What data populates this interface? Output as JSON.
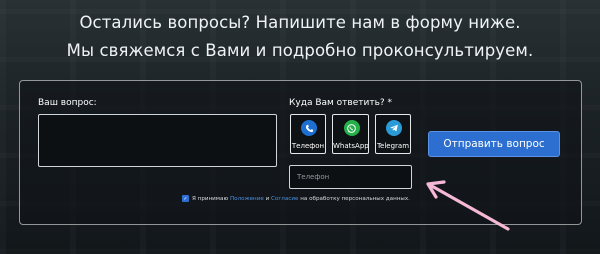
{
  "headline": {
    "line1": "Остались вопросы? Напишите нам в форму ниже.",
    "line2": "Мы свяжемся с Вами и подробно проконсультируем."
  },
  "form": {
    "question_label": "Ваш вопрос:",
    "question_value": "",
    "reply_label": "Куда Вам ответить? *",
    "methods": [
      {
        "label": "Телефон",
        "icon": "phone-icon",
        "color": "#1d6fd0"
      },
      {
        "label": "WhatsApp",
        "icon": "whatsapp-icon",
        "color": "#25b14a"
      },
      {
        "label": "Telegram",
        "icon": "telegram-icon",
        "color": "#2b9bd8"
      }
    ],
    "phone_placeholder": "Телефон",
    "submit_label": "Отправить вопрос",
    "consent": {
      "prefix": "Я принимаю",
      "link1": "Положение",
      "and": "и",
      "link2": "Согласие",
      "suffix": "на обработку персональных данных."
    }
  },
  "colors": {
    "accent": "#2c6fd0",
    "link": "#4a90e2",
    "annotation_arrow": "#f5b8d6"
  }
}
